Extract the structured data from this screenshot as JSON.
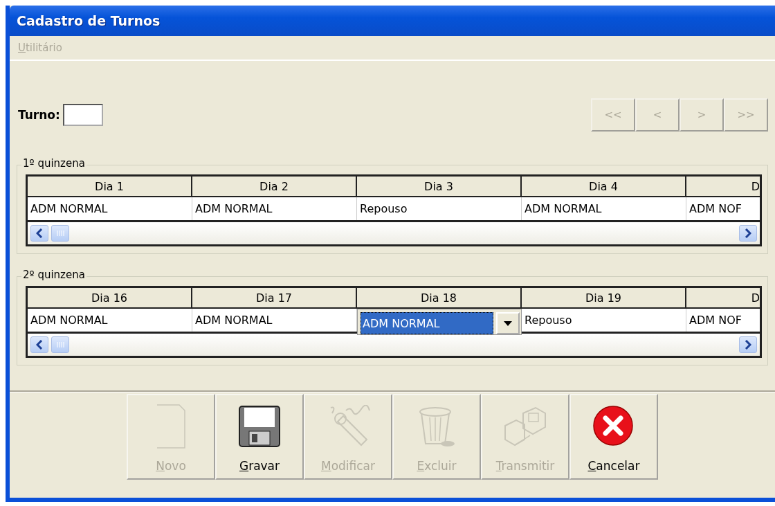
{
  "window": {
    "title": "Cadastro de Turnos"
  },
  "menu": [
    {
      "label": "Utilitário",
      "mnemonic_underlined": true,
      "disabled": true
    }
  ],
  "turno": {
    "label": "Turno:"
  },
  "nav_buttons": [
    {
      "label": "<<",
      "disabled": true
    },
    {
      "label": "<",
      "disabled": true
    },
    {
      "label": ">",
      "disabled": true
    },
    {
      "label": ">>",
      "disabled": true
    }
  ],
  "groups": [
    {
      "title": "1º quinzena",
      "columns": [
        "Dia 1",
        "Dia 2",
        "Dia 3",
        "Dia 4",
        "D"
      ],
      "cells": [
        {
          "value": "ADM NORMAL",
          "selected": false
        },
        {
          "value": "ADM NORMAL",
          "selected": false
        },
        {
          "value": "Repouso",
          "selected": false
        },
        {
          "value": "ADM NORMAL",
          "selected": false
        },
        {
          "value": "ADM NOF",
          "selected": false
        }
      ]
    },
    {
      "title": "2º quinzena",
      "columns": [
        "Dia 16",
        "Dia 17",
        "Dia 18",
        "Dia 19",
        "D"
      ],
      "cells": [
        {
          "value": "ADM NORMAL",
          "selected": false
        },
        {
          "value": "ADM NORMAL",
          "selected": false
        },
        {
          "value": "ADM NORMAL",
          "selected": true
        },
        {
          "value": "Repouso",
          "selected": false
        },
        {
          "value": "ADM NOF",
          "selected": false
        }
      ]
    }
  ],
  "toolbar": [
    {
      "label": "Novo",
      "mnemonic_underlined": true,
      "kind": "page",
      "disabled": true
    },
    {
      "label": "Gravar",
      "mnemonic_underlined": true,
      "kind": "floppy",
      "disabled": false
    },
    {
      "label": "Modificar",
      "mnemonic_underlined": true,
      "kind": "modify",
      "disabled": true
    },
    {
      "label": "Excluir",
      "mnemonic_underlined": true,
      "kind": "trash",
      "disabled": true
    },
    {
      "label": "Transmitir",
      "mnemonic_underlined": true,
      "kind": "computers",
      "disabled": true
    },
    {
      "label": "Cancelar",
      "mnemonic_underlined": true,
      "kind": "cancel",
      "disabled": false
    }
  ]
}
